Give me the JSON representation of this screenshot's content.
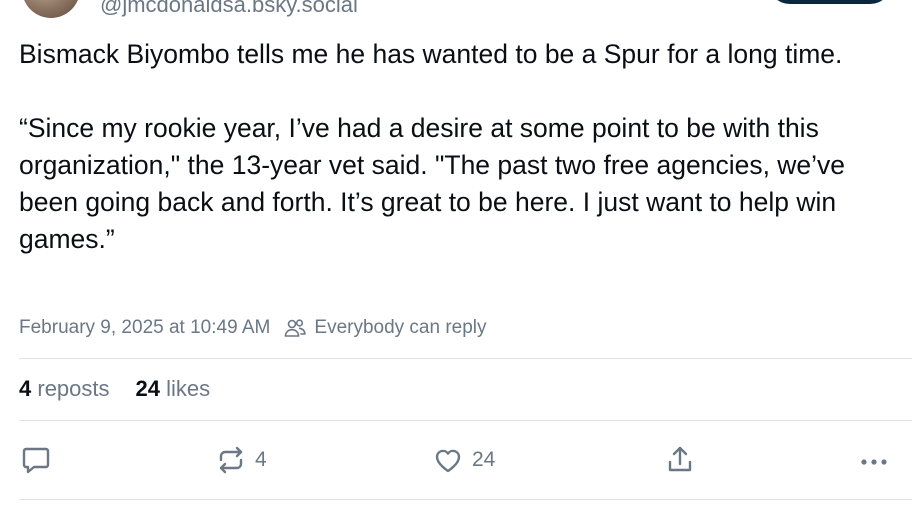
{
  "author": {
    "handle": "@jmcdonaldsa.bsky.social",
    "avatar_icon": "avatar"
  },
  "post": {
    "paragraphs": [
      "Bismack Biyombo tells me he has wanted to be a Spur for a long time.",
      "“Since my rookie year, I’ve had a desire at some point to be with this organization,\" the 13-year vet said. \"The past two free agencies, we’ve been going back and forth. It’s great to be here. I just want to help win games.”"
    ],
    "timestamp": "February 9, 2025 at 10:49 AM",
    "reply_setting": "Everybody can reply"
  },
  "stats": {
    "reposts_count": "4",
    "reposts_label": "reposts",
    "likes_count": "24",
    "likes_label": "likes"
  },
  "actions": {
    "reply_icon": "reply-icon",
    "repost_icon": "repost-icon",
    "repost_count": "4",
    "like_icon": "heart-icon",
    "like_count": "24",
    "share_icon": "share-icon",
    "more_icon": "more-icon"
  },
  "colors": {
    "text": "#0b0f14",
    "muted": "#6b7785",
    "divider": "#dfe3e8",
    "follow_button": "#0b2740"
  }
}
